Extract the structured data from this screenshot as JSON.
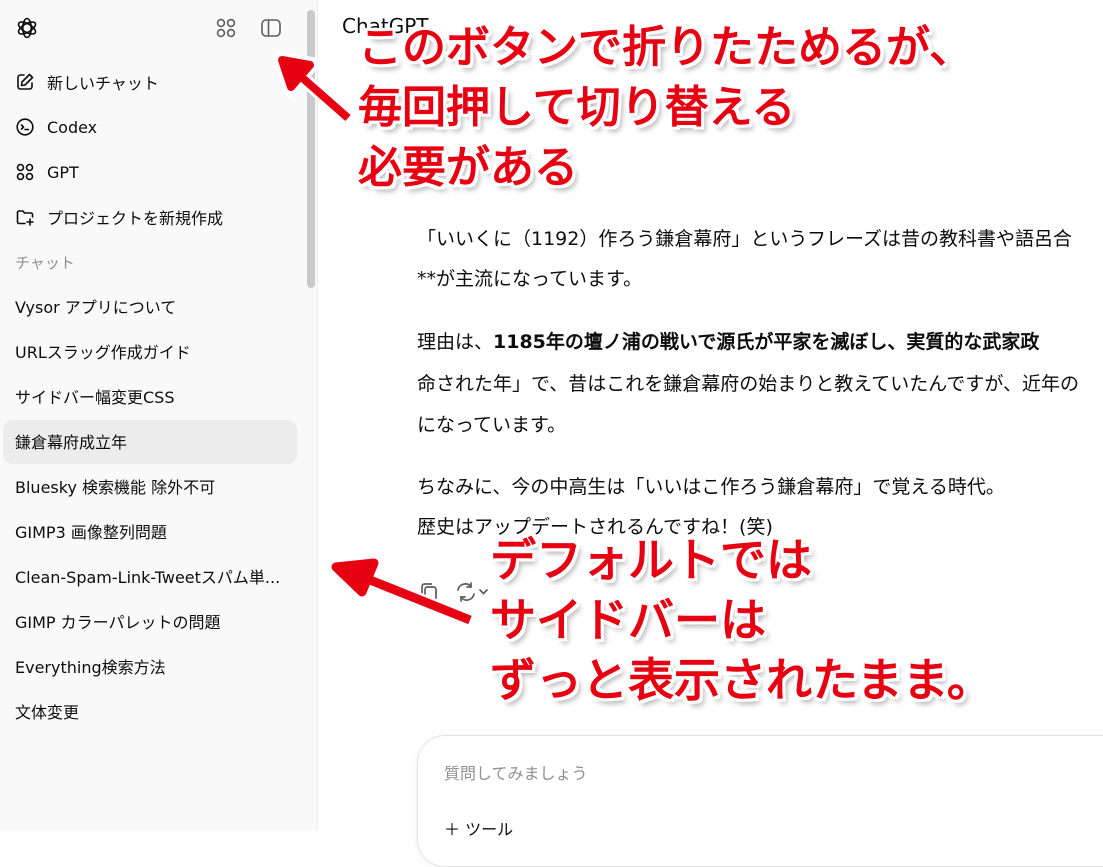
{
  "sidebar": {
    "logo_icon": "openai-logo-icon",
    "top_icons": [
      "apps-grid-icon",
      "sidebar-toggle-icon"
    ],
    "nav": [
      {
        "label": "新しいチャット",
        "icon": "edit-icon"
      },
      {
        "label": "Codex",
        "icon": "codex-icon"
      },
      {
        "label": "GPT",
        "icon": "apps-grid-icon"
      },
      {
        "label": "プロジェクトを新規作成",
        "icon": "folder-plus-icon"
      }
    ],
    "section_label": "チャット",
    "chats": [
      "Vysor アプリについて",
      "URLスラッグ作成ガイド",
      "サイドバー幅変更CSS",
      "鎌倉幕府成立年",
      "Bluesky 検索機能 除外不可",
      "GIMP3 画像整列問題",
      "Clean-Spam-Link-Tweetスパム単...",
      "GIMP カラーパレットの問題",
      "Everything検索方法",
      "文体変更"
    ],
    "active_chat_index": 3
  },
  "main": {
    "title": "ChatGPT",
    "message": {
      "p1_line1": "「いいくに（1192）作ろう鎌倉幕府」というフレーズは昔の教科書や語呂合",
      "p1_line2": "**が主流になっています。",
      "p2_line1_a": "理由は、",
      "p2_line1_b": "1185年の壇ノ浦の戦いで源氏が平家を滅ぼし、実質的な武家政",
      "p2_line2": "命された年」で、昔はこれを鎌倉幕府の始まりと教えていたんですが、近年の",
      "p2_line3": "になっています。",
      "p3_line1": "ちなみに、今の中高生は「いいはこ作ろう鎌倉幕府」で覚える時代。",
      "p3_line2": "歴史はアップデートされるんですね！(笑)"
    },
    "actions": [
      "copy-icon",
      "regenerate-icon"
    ],
    "composer": {
      "placeholder": "質問してみましょう",
      "tools_label": "ツール"
    }
  },
  "annotations": {
    "top": [
      "このボタンで折りたためるが、",
      "毎回押して切り替える",
      "必要がある"
    ],
    "bottom": [
      "デフォルトでは",
      "サイドバーは",
      "ずっと表示されたまま。"
    ],
    "color": "#e60012"
  }
}
